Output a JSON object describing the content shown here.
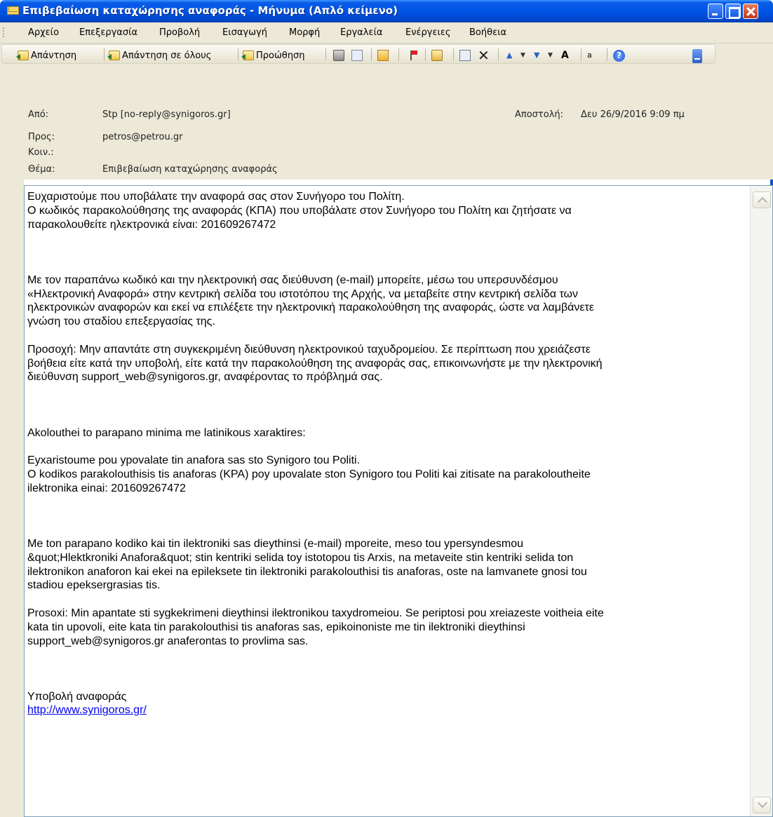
{
  "window": {
    "title": "Επιβεβαίωση καταχώρησης αναφοράς - Μήνυμα (Απλό κείμενο)"
  },
  "menu": {
    "items": [
      "Αρχείο",
      "Επεξεργασία",
      "Προβολή",
      "Εισαγωγή",
      "Μορφή",
      "Εργαλεία",
      "Ενέργειες",
      "Βοήθεια"
    ]
  },
  "toolbar": {
    "reply": "Απάντηση",
    "reply_all": "Απάντηση σε όλους",
    "forward": "Προώθηση",
    "help_glyph": "?",
    "font_glyph": "A",
    "translate_glyph": "a"
  },
  "header": {
    "from_label": "Από:",
    "from_value": "Stp [no-reply@synigoros.gr]",
    "sent_label": "Αποστολή:",
    "sent_value": "Δευ 26/9/2016 9:09 πμ",
    "to_label": "Προς:",
    "to_value": "petros@petrou.gr",
    "cc_label": "Κοιν.:",
    "cc_value": "",
    "subject_label": "Θέμα:",
    "subject_value": "Επιβεβαίωση καταχώρησης αναφοράς"
  },
  "body": {
    "p1": "Ευχαριστούμε που υποβάλατε την αναφορά σας στον Συνήγορο του Πολίτη.\nΟ κωδικός παρακολούθησης της αναφοράς (ΚΠΑ) που υποβάλατε στον Συνήγορο του Πολίτη και ζητήσατε να\nπαρακολουθείτε ηλεκτρονικά είναι: 201609267472",
    "p2": "Με τον παραπάνω κωδικό και την ηλεκτρονική σας διεύθυνση (e-mail) μπορείτε, μέσω του υπερσυνδέσμου\n«Ηλεκτρονική Αναφορά» στην κεντρική σελίδα του ιστοτόπου της Αρχής, να μεταβείτε στην κεντρική σελίδα των\nηλεκτρονικών αναφορών και εκεί να επιλέξετε την ηλεκτρονική παρακολούθηση της αναφοράς, ώστε να λαμβάνετε\nγνώση του σταδίου επεξεργασίας της.",
    "p3": "Προσοχή: Μην απαντάτε στη συγκεκριμένη διεύθυνση ηλεκτρονικού ταχυδρομείου. Σε περίπτωση που χρειάζεστε\nβοήθεια είτε κατά την υποβολή, είτε κατά την παρακολούθηση της αναφοράς σας, επικοινωνήστε με την ηλεκτρονική\nδιεύθυνση support_web@synigoros.gr, αναφέροντας το πρόβλημά σας.",
    "p4": "Akolouthei to parapano minima me latinikous xaraktires:",
    "p5": "Eyxaristoume pou ypovalate tin anafora sas sto Synigoro tou Politi.\nO kodikos parakolouthisis tis anaforas (KPA) poy upovalate ston Synigoro tou Politi kai zitisate na parakoloutheite\nilektronika einai: 201609267472",
    "p6": "Me ton parapano kodiko kai tin ilektroniki sas dieythinsi (e-mail) mporeite, meso tou ypersyndesmou\n&quot;Hlektkroniki Anafora&quot; stin kentriki selida toy istotopou tis Arxis, na metaveite stin kentriki selida ton\nilektronikon anaforon kai ekei na epileksete tin ilektroniki parakolouthisi tis anaforas, oste na lamvanete gnosi tou\nstadiou epeksergrasias tis.",
    "p7": "Prosoxi: Min apantate sti sygkekrimeni dieythinsi ilektronikou taxydromeiou. Se periptosi pou xreiazeste voitheia eite\nkata tin upovoli, eite kata tin parakolouthisi tis anaforas sas, epikoinoniste me tin ilektroniki dieythinsi\nsupport_web@synigoros.gr anaferontas to provlima sas.",
    "signature": "Υποβολή αναφοράς",
    "link": "http://www.synigoros.gr/"
  }
}
